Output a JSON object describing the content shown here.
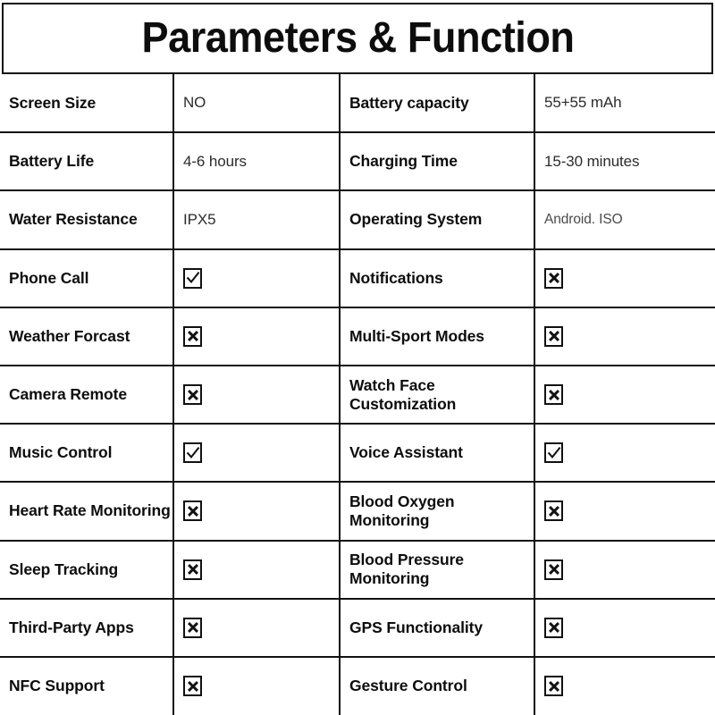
{
  "header": {
    "title": "Parameters & Function"
  },
  "legend": {
    "checked_icon": "checked-checkbox-icon",
    "crossed_icon": "crossed-checkbox-icon"
  },
  "table": {
    "rows": [
      {
        "left_label": "Screen Size",
        "left_type": "text",
        "left_value": "NO",
        "right_label": "Battery capacity",
        "right_type": "text",
        "right_value": "55+55 mAh"
      },
      {
        "left_label": "Battery Life",
        "left_type": "text",
        "left_value": "4-6 hours",
        "right_label": "Charging Time",
        "right_type": "text",
        "right_value": "15-30 minutes"
      },
      {
        "left_label": "Water Resistance",
        "left_type": "text",
        "left_value": "IPX5",
        "right_label": "Operating System",
        "right_type": "text-small",
        "right_value": "Android. ISO"
      },
      {
        "left_label": "Phone Call",
        "left_type": "check",
        "left_value": "checked",
        "right_label": "Notifications",
        "right_type": "check",
        "right_value": "crossed"
      },
      {
        "left_label": "Weather Forcast",
        "left_type": "check",
        "left_value": "crossed",
        "right_label": "Multi-Sport Modes",
        "right_type": "check",
        "right_value": "crossed"
      },
      {
        "left_label": "Camera Remote",
        "left_type": "check",
        "left_value": "crossed",
        "right_label": "Watch Face Customization",
        "right_type": "check",
        "right_value": "crossed"
      },
      {
        "left_label": "Music Control",
        "left_type": "check",
        "left_value": "checked",
        "right_label": "Voice Assistant",
        "right_type": "check",
        "right_value": "checked"
      },
      {
        "left_label": "Heart Rate Monitoring",
        "left_type": "check",
        "left_value": "crossed",
        "right_label": "Blood Oxygen Monitoring",
        "right_type": "check",
        "right_value": "crossed"
      },
      {
        "left_label": "Sleep Tracking",
        "left_type": "check",
        "left_value": "crossed",
        "right_label": "Blood Pressure Monitoring",
        "right_type": "check",
        "right_value": "crossed"
      },
      {
        "left_label": "Third-Party Apps",
        "left_type": "check",
        "left_value": "crossed",
        "right_label": "GPS Functionality",
        "right_type": "check",
        "right_value": "crossed"
      },
      {
        "left_label": "NFC Support",
        "left_type": "check",
        "left_value": "crossed",
        "right_label": "Gesture Control",
        "right_type": "check",
        "right_value": "crossed"
      }
    ]
  },
  "colors": {
    "border": "#111111",
    "label_text": "#0d0d0d",
    "value_text": "#2b2b2b",
    "background": "#ffffff"
  }
}
